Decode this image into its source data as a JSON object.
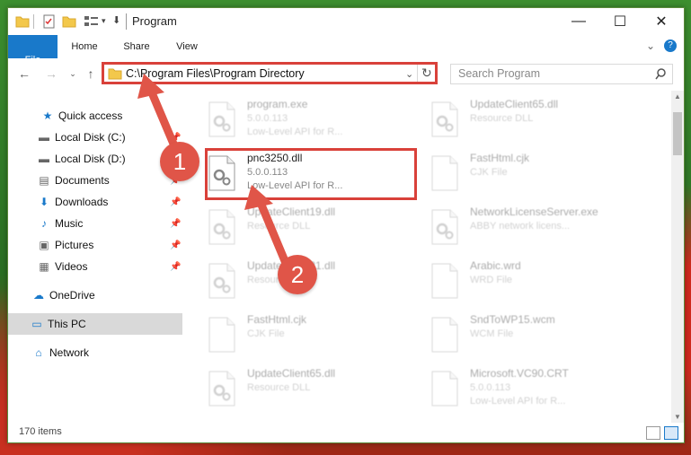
{
  "window": {
    "title": "Program"
  },
  "ribbon": {
    "tabs": [
      "File",
      "Home",
      "Share",
      "View"
    ]
  },
  "nav": {
    "address": "C:\\Program Files\\Program Directory",
    "search_placeholder": "Search Program"
  },
  "sidebar": {
    "items": [
      {
        "label": "Quick access",
        "icon": "star-icon"
      },
      {
        "label": "Local Disk (C:)",
        "icon": "drive-icon",
        "pinned": true
      },
      {
        "label": "Local Disk (D:)",
        "icon": "drive-icon",
        "pinned": true
      },
      {
        "label": "Documents",
        "icon": "documents-icon",
        "pinned": true
      },
      {
        "label": "Downloads",
        "icon": "download-icon",
        "pinned": true
      },
      {
        "label": "Music",
        "icon": "music-icon",
        "pinned": true
      },
      {
        "label": "Pictures",
        "icon": "pictures-icon",
        "pinned": true
      },
      {
        "label": "Videos",
        "icon": "videos-icon",
        "pinned": true
      },
      {
        "label": "OneDrive",
        "icon": "cloud-icon"
      },
      {
        "label": "This PC",
        "icon": "pc-icon",
        "selected": true
      },
      {
        "label": "Network",
        "icon": "network-icon"
      }
    ]
  },
  "files": [
    {
      "name": "program.exe",
      "line1": "5.0.0.113",
      "line2": "Low-Level API for R...",
      "faded": true
    },
    {
      "name": "UpdateClient65.dll",
      "line1": "Resource DLL",
      "line2": "",
      "faded": true
    },
    {
      "name": "pnc3250.dll",
      "line1": "5.0.0.113",
      "line2": "Low-Level API for R...",
      "faded": false
    },
    {
      "name": "FastHtml.cjk",
      "line1": "CJK File",
      "line2": "",
      "faded": true
    },
    {
      "name": "UpdateClient19.dll",
      "line1": "Resource DLL",
      "line2": "",
      "faded": true
    },
    {
      "name": "NetworkLicenseServer.exe",
      "line1": "ABBY network licens...",
      "line2": "",
      "faded": true
    },
    {
      "name": "UpdateClient21.dll",
      "line1": "Resource DLL",
      "line2": "",
      "faded": true
    },
    {
      "name": "Arabic.wrd",
      "line1": "WRD File",
      "line2": "",
      "faded": true
    },
    {
      "name": "FastHtml.cjk",
      "line1": "CJK File",
      "line2": "",
      "faded": true
    },
    {
      "name": "SndToWP15.wcm",
      "line1": "WCM File",
      "line2": "",
      "faded": true
    },
    {
      "name": "UpdateClient65.dll",
      "line1": "Resource DLL",
      "line2": "",
      "faded": true
    },
    {
      "name": "Microsoft.VC90.CRT",
      "line1": "5.0.0.113",
      "line2": "Low-Level API for R...",
      "faded": true
    }
  ],
  "status": {
    "count": "170 items"
  },
  "annotations": [
    "1",
    "2"
  ],
  "colors": {
    "accent": "#1979ca",
    "highlight": "#d9413a",
    "arrow": "#e05548"
  }
}
